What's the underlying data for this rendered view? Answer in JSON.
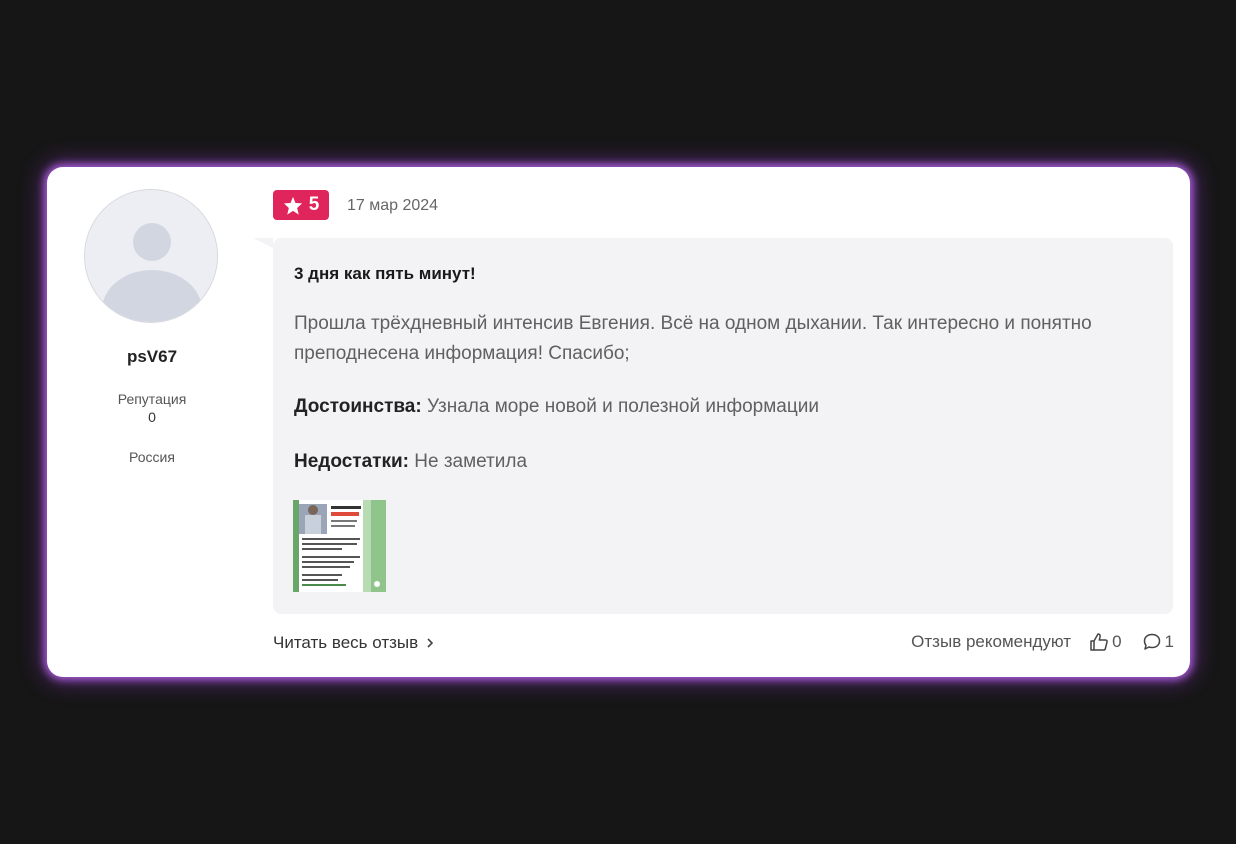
{
  "user": {
    "username": "psV67",
    "reputation_label": "Репутация",
    "reputation_value": "0",
    "country": "Россия",
    "avatar_icon": "user-avatar-placeholder-icon"
  },
  "review": {
    "rating": "5",
    "rating_icon": "star-icon",
    "rating_color": "#e0245c",
    "date": "17 мар 2024",
    "title": "3 дня как пять минут!",
    "text": "Прошла трёхдневный интенсив Евгения. Всё на одном дыхании. Так интересно и понятно преподнесена информация! Спасибо;",
    "pros_label": "Достоинства:",
    "pros_text": "Узнала море новой и полезной информации",
    "cons_label": "Недостатки:",
    "cons_text": "Не заметила"
  },
  "footer": {
    "read_more": "Читать весь отзыв",
    "read_more_icon": "chevron-right-icon",
    "recommend_label": "Отзыв рекомендуют",
    "likes_count": "0",
    "likes_icon": "thumbs-up-icon",
    "comments_count": "1",
    "comments_icon": "comment-icon"
  }
}
